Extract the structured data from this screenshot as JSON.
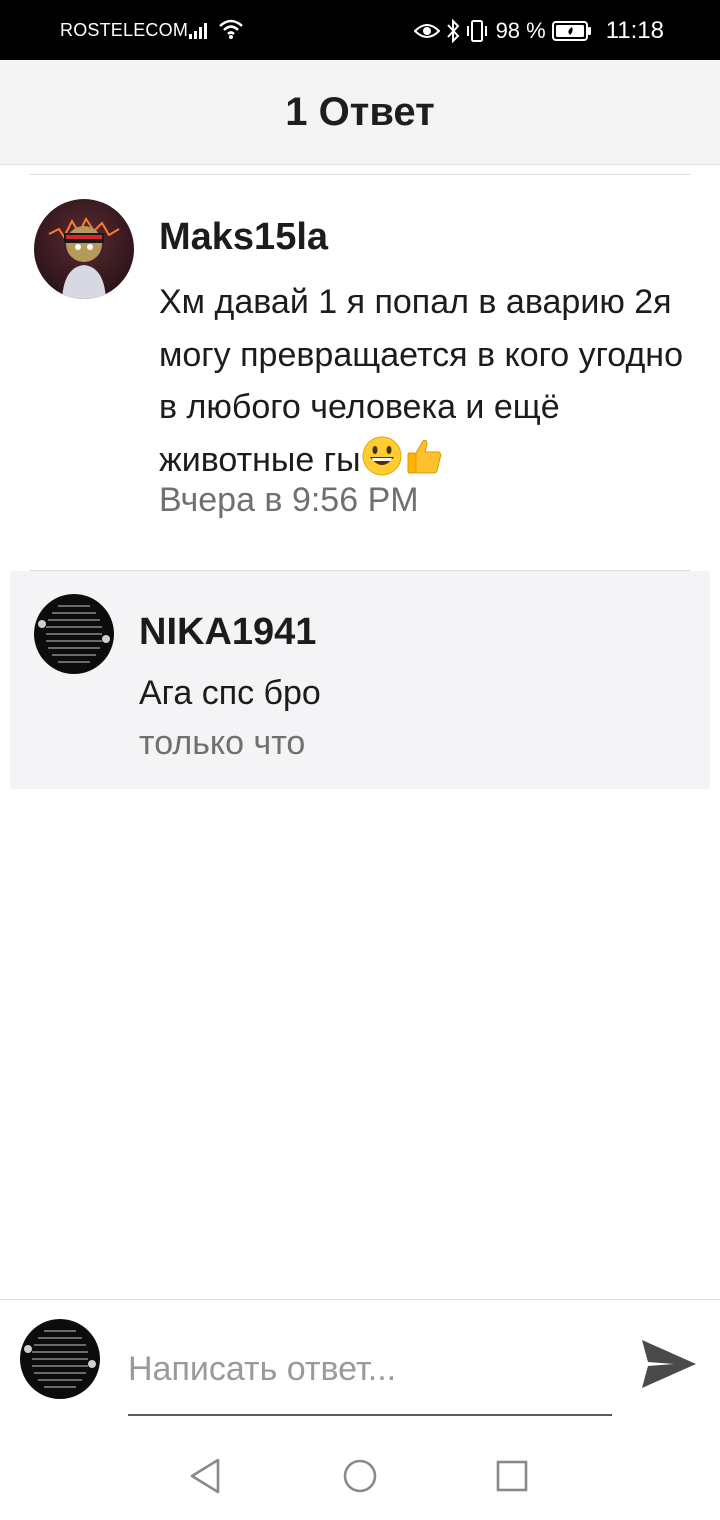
{
  "status_bar": {
    "carrier": "ROSTELECOM",
    "battery": "98 %",
    "time": "11:18",
    "icons": [
      "signal-icon",
      "wifi-icon",
      "eye-icon",
      "bluetooth-icon",
      "vibrate-icon",
      "battery-icon"
    ]
  },
  "header": {
    "title": "1 Ответ"
  },
  "comments": [
    {
      "author": "Maks15la",
      "text": "Хм давай 1 я попал в аварию 2я могу превращается в кого угодно в любого человека и ещё животные гы",
      "emojis": [
        "grinning-face-emoji",
        "thumbs-up-emoji"
      ],
      "time": "Вчера в 9:56 PM"
    },
    {
      "author": "NIKA1941",
      "text": "Ага спс бро",
      "time": "только что"
    }
  ],
  "reply_bar": {
    "placeholder": "Написать ответ..."
  },
  "nav_bar": {
    "icons": [
      "back-icon",
      "home-icon",
      "recents-icon"
    ]
  },
  "colors": {
    "header_bg": "#f4f4f4",
    "reply_highlight": "#f4f4f6",
    "timestamp": "#707070",
    "send_icon": "#4a4a4a"
  }
}
